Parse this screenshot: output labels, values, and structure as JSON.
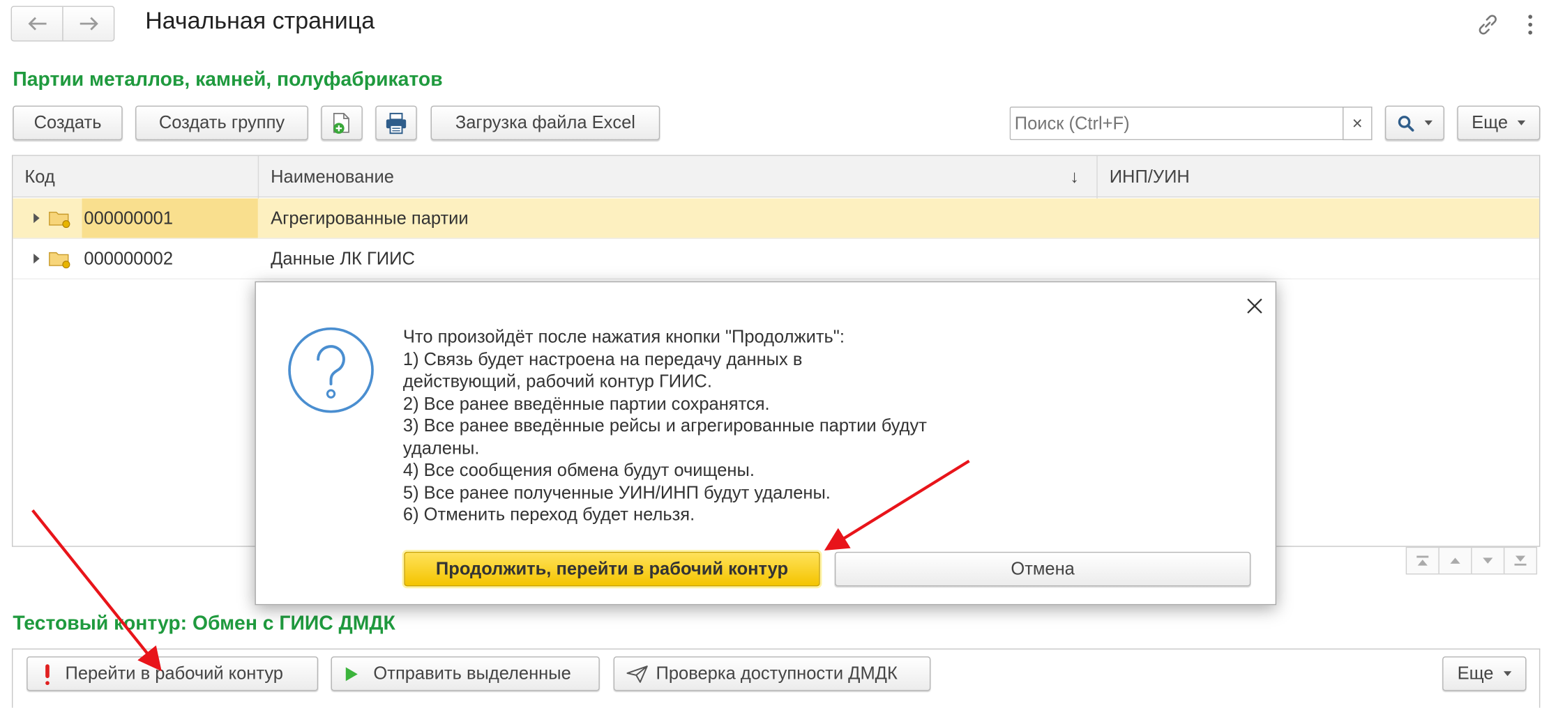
{
  "header": {
    "title": "Начальная страница"
  },
  "catalog": {
    "title": "Партии металлов, камней, полуфабрикатов",
    "toolbar": {
      "create": "Создать",
      "create_group": "Создать группу",
      "excel_load": "Загрузка файла Excel",
      "search_placeholder": "Поиск (Ctrl+F)",
      "clear": "×",
      "more": "Еще"
    },
    "columns": [
      "Код",
      "Наименование",
      "ИНП/УИН"
    ],
    "sort_indicator": "↓",
    "rows": [
      {
        "code": "000000001",
        "name": "Агрегированные партии",
        "inp": ""
      },
      {
        "code": "000000002",
        "name": "Данные ЛК ГИИС",
        "inp": ""
      }
    ]
  },
  "dialog": {
    "lines": [
      "Что произойдёт после нажатия кнопки \"Продолжить\":",
      "1) Связь будет настроена на передачу данных в",
      "действующий, рабочий контур ГИИС.",
      "2) Все ранее введённые партии сохранятся.",
      "3) Все ранее введённые рейсы и агрегированные партии будут",
      "удалены.",
      "4) Все сообщения обмена будут очищены.",
      "5) Все ранее полученные УИН/ИНП будут удалены.",
      "6) Отменить переход будет нельзя."
    ],
    "continue_label": "Продолжить, перейти в рабочий контур",
    "cancel_label": "Отмена"
  },
  "exchange": {
    "title": "Тестовый контур: Обмен с ГИИС ДМДК",
    "go_work": "Перейти в рабочий контур",
    "send_selected": "Отправить выделенные",
    "check_access": "Проверка доступности ДМДК",
    "more": "Еще"
  },
  "colors": {
    "accent_green": "#1f9a3e",
    "selected_row": "#fdf0c0",
    "primary_button": "#f4c400",
    "annotation_arrow": "#e8141a"
  }
}
